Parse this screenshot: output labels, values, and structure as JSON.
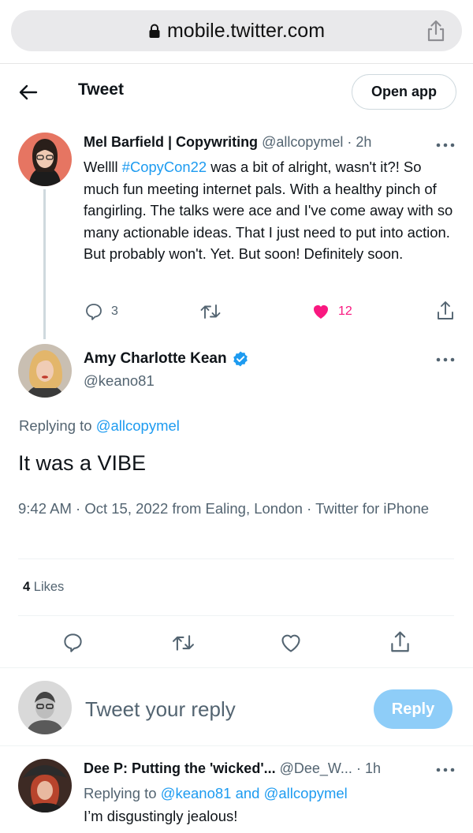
{
  "browser": {
    "url": "mobile.twitter.com"
  },
  "header": {
    "title": "Tweet",
    "open_app": "Open app"
  },
  "parent_tweet": {
    "name": "Mel Barfield | Copywriting",
    "handle": "@allcopymel",
    "sep": "·",
    "time": "2h",
    "text_before": "Wellll ",
    "hashtag": "#CopyCon22",
    "text_after": " was a bit of alright, wasn't it?! So much fun meeting internet pals. With a healthy pinch of fangirling. The talks were ace and I've come away with so many actionable ideas. That I just need to put into action. But probably won't. Yet. But soon! Definitely soon.",
    "reply_count": "3",
    "like_count": "12"
  },
  "main_tweet": {
    "name": "Amy Charlotte Kean",
    "handle": "@keano81",
    "replying_prefix": "Replying to ",
    "replying_to": "@allcopymel",
    "text": "It was a VIBE",
    "meta": "9:42 AM · Oct 15, 2022 from Ealing, London · Twitter for iPhone",
    "likes_count": "4",
    "likes_label": " Likes"
  },
  "composer": {
    "placeholder": "Tweet your reply",
    "button": "Reply"
  },
  "reply_tweet": {
    "name": "Dee P: Putting the 'wicked'...",
    "handle": "@Dee_W...",
    "sep": "·",
    "time": "1h",
    "replying_prefix": "Replying to ",
    "replying_to": "@keano81 and @allcopymel",
    "text": "I’m disgustingly jealous!"
  },
  "colors": {
    "accent": "#1d9bf0",
    "like": "#f91880",
    "muted": "#536471",
    "reply_button": "#8ecdf8"
  }
}
